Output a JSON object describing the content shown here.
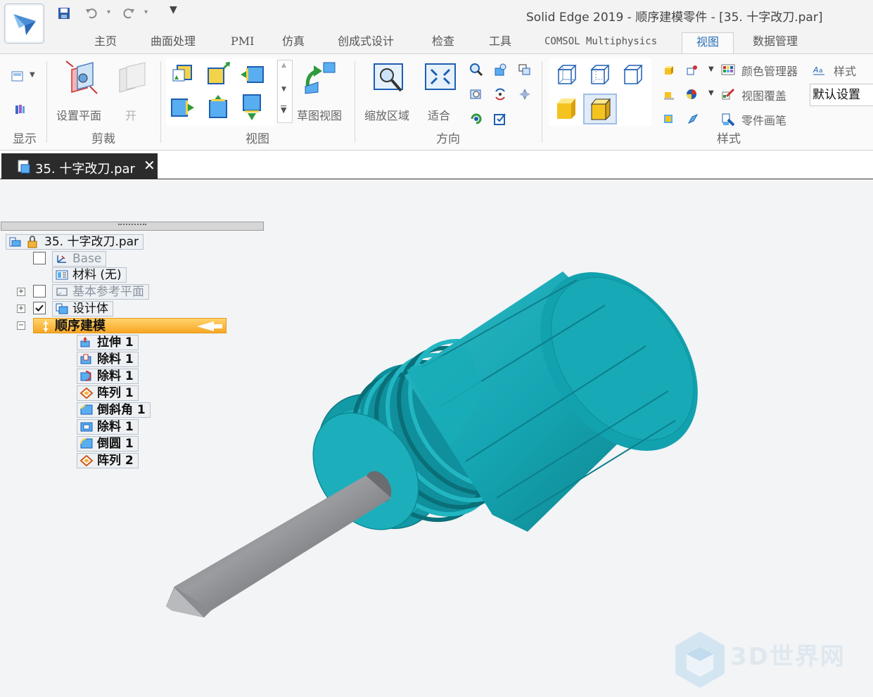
{
  "window": {
    "title": "Solid Edge 2019 - 顺序建模零件 - [35. 十字改刀.par]"
  },
  "menu_tabs": [
    {
      "label": "主页"
    },
    {
      "label": "曲面处理"
    },
    {
      "label": "PMI"
    },
    {
      "label": "仿真"
    },
    {
      "label": "创成式设计"
    },
    {
      "label": "检查"
    },
    {
      "label": "工具"
    },
    {
      "label": "COMSOL Multiphysics"
    },
    {
      "label": "视图",
      "active": true
    },
    {
      "label": "数据管理"
    }
  ],
  "ribbon": {
    "groups": {
      "display": "显示",
      "clip": "剪裁",
      "views": "视图",
      "orient": "方向",
      "style": "样式"
    },
    "buttons": {
      "set_plane": "设置平面",
      "open": "开",
      "sketch_view": "草图视图",
      "zoom_area": "缩放区域",
      "fit": "适合",
      "color_manager": "颜色管理器",
      "style": "样式",
      "view_overrides": "视图覆盖",
      "part_painter": "零件画笔"
    },
    "style_select": "默认设置"
  },
  "document_tab": {
    "label": "35. 十字改刀.par"
  },
  "tree": {
    "root": "35. 十字改刀.par",
    "base": "Base",
    "material": "材料 (无)",
    "ref_planes": "基本参考平面",
    "design_body": "设计体",
    "sequential": "顺序建模",
    "features": [
      {
        "label": "拉伸 1",
        "icon": "extrude-icon"
      },
      {
        "label": "除料 1",
        "icon": "cutout-icon"
      },
      {
        "label": "除料 1",
        "icon": "revolved-cutout-icon"
      },
      {
        "label": "阵列 1",
        "icon": "pattern-icon"
      },
      {
        "label": "倒斜角 1",
        "icon": "chamfer-icon"
      },
      {
        "label": "除料 1",
        "icon": "cutout-icon"
      },
      {
        "label": "倒圆 1",
        "icon": "round-icon"
      },
      {
        "label": "阵列 2",
        "icon": "pattern-icon"
      }
    ]
  },
  "watermark": "3D世界网"
}
